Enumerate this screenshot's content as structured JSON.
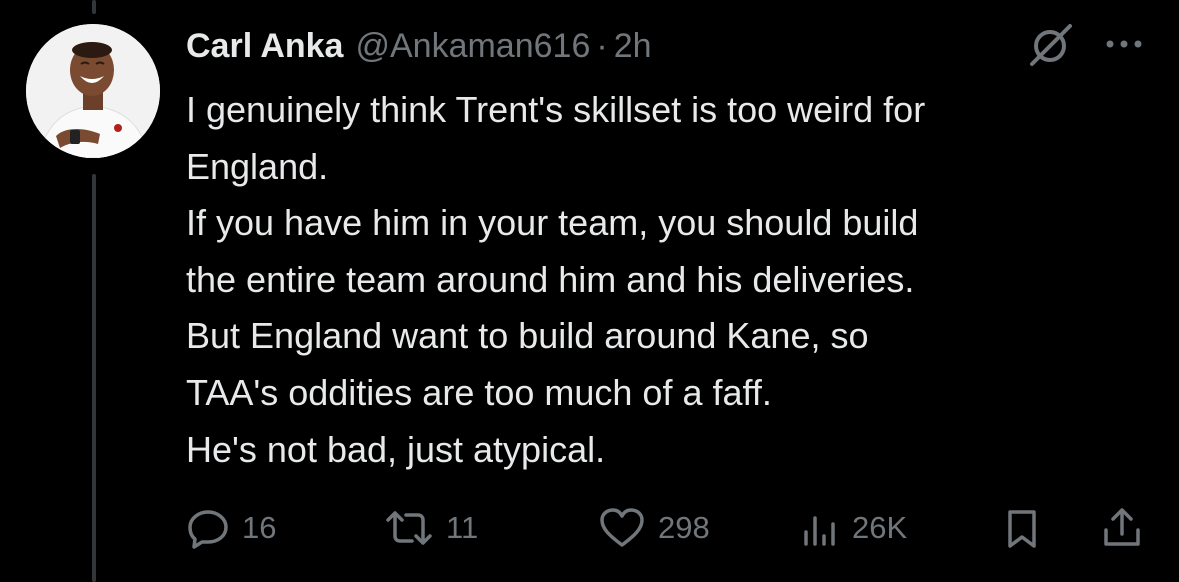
{
  "tweet": {
    "author": {
      "display_name": "Carl Anka",
      "handle": "@Ankaman616",
      "avatar_icon": "profile-photo"
    },
    "separator": "·",
    "timestamp": "2h",
    "lines": [
      "I genuinely think Trent's skillset is too weird for",
      "England.",
      "If you have him in your team, you should build",
      "the entire team around him and his deliveries.",
      "But England want to build around Kane, so",
      "TAA's oddities are too much of a faff.",
      "He's not bad, just atypical."
    ],
    "header_icons": [
      "grok-icon",
      "more-icon"
    ]
  },
  "actions": {
    "replies": "16",
    "reposts": "11",
    "likes": "298",
    "views": "26K",
    "icons": [
      "reply-icon",
      "retweet-icon",
      "heart-icon",
      "views-icon",
      "bookmark-icon",
      "share-icon"
    ]
  },
  "colors": {
    "background": "#000000",
    "text_primary": "#e7e9ea",
    "text_secondary": "#71767b",
    "thread_line": "#333639"
  }
}
